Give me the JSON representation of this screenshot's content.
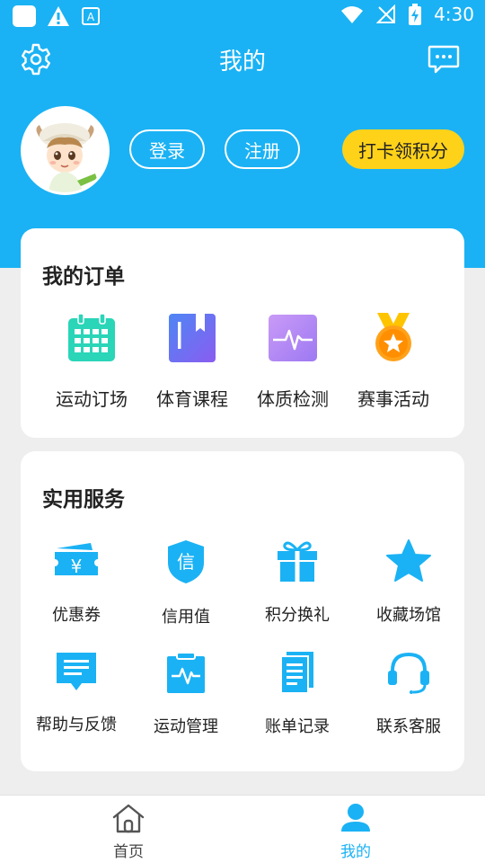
{
  "status_bar": {
    "time": "4:30"
  },
  "header": {
    "title": "我的"
  },
  "profile": {
    "login_label": "登录",
    "register_label": "注册",
    "checkin_label": "打卡领积分"
  },
  "orders": {
    "title": "我的订单",
    "items": [
      {
        "label": "运动订场",
        "icon": "calendar-icon"
      },
      {
        "label": "体育课程",
        "icon": "bookmark-book-icon"
      },
      {
        "label": "体质检测",
        "icon": "heartbeat-monitor-icon"
      },
      {
        "label": "赛事活动",
        "icon": "medal-icon"
      }
    ]
  },
  "services": {
    "title": "实用服务",
    "items": [
      {
        "label": "优惠券",
        "icon": "coupon-ticket-icon"
      },
      {
        "label": "信用值",
        "icon": "credit-shield-icon",
        "glyph": "信"
      },
      {
        "label": "积分换礼",
        "icon": "gift-icon"
      },
      {
        "label": "收藏场馆",
        "icon": "star-icon"
      },
      {
        "label": "帮助与反馈",
        "icon": "feedback-message-icon"
      },
      {
        "label": "运动管理",
        "icon": "clipboard-pulse-icon"
      },
      {
        "label": "账单记录",
        "icon": "document-list-icon"
      },
      {
        "label": "联系客服",
        "icon": "headset-icon"
      }
    ]
  },
  "bottom_nav": {
    "home_label": "首页",
    "mine_label": "我的"
  },
  "colors": {
    "brand_blue": "#1ab2f4",
    "checkin_yellow": "#ffd21a",
    "calendar_green": "#2ad5b8",
    "book_purple": "#6f6ef0",
    "monitor_purple": "#b48ef5",
    "medal_orange": "#ffa21a"
  }
}
